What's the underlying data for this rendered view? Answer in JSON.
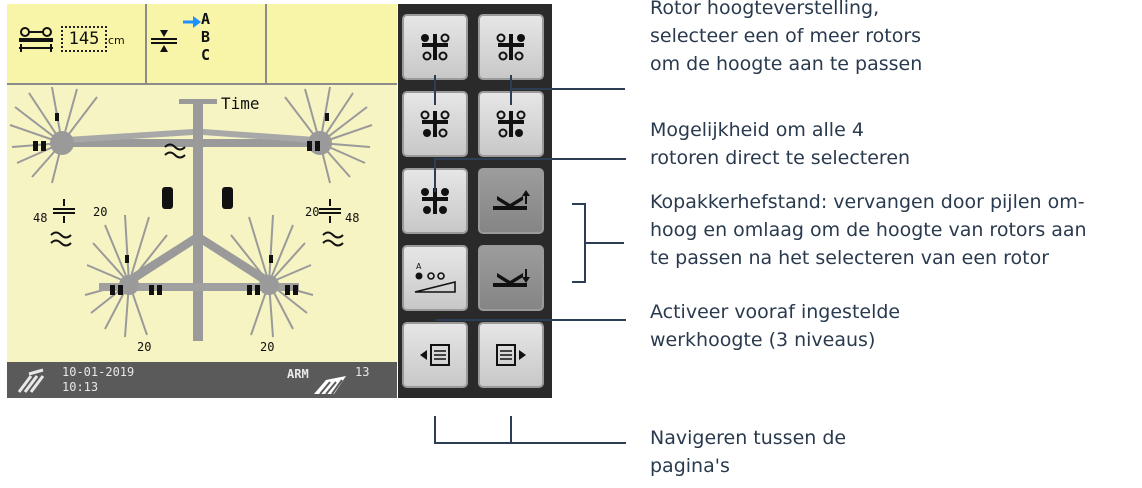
{
  "screen": {
    "topbar": {
      "height_value": "145",
      "height_unit": "cm",
      "levels": [
        "A",
        "B",
        "C"
      ]
    },
    "field": {
      "time_label": "Time",
      "width_left": "48",
      "width_right": "48",
      "distance_left": "20",
      "distance_right": "20",
      "rear_left": "20",
      "rear_right": "20"
    },
    "status": {
      "date": "10-01-2019",
      "time": "10:13",
      "mode": "ARM",
      "count": "13"
    }
  },
  "buttons": [
    {
      "name": "rotor-left-front-button",
      "icon": "rotor-select-icon"
    },
    {
      "name": "rotor-right-front-button",
      "icon": "rotor-select-icon"
    },
    {
      "name": "rotor-left-rear-button",
      "icon": "rotor-select-icon"
    },
    {
      "name": "rotor-right-rear-button",
      "icon": "rotor-select-icon"
    },
    {
      "name": "all-rotors-button",
      "icon": "all-rotors-icon"
    },
    {
      "name": "headland-raise-button",
      "icon": "headland-up-icon"
    },
    {
      "name": "preset-height-button",
      "icon": "preset-height-icon"
    },
    {
      "name": "headland-lower-button",
      "icon": "headland-down-icon"
    },
    {
      "name": "page-prev-button",
      "icon": "page-prev-icon"
    },
    {
      "name": "page-next-button",
      "icon": "page-next-icon"
    }
  ],
  "annotations": {
    "rotor_height": [
      "Rotor hoogteverstelling,",
      "selecteer een of meer rotors",
      "om de hoogte aan te passen"
    ],
    "all_rotors": [
      "Mogelijkheid om alle 4",
      "rotoren direct te selecteren"
    ],
    "headland": [
      "Kopakkerhefstand: vervangen door pijlen om-",
      "hoog en omlaag om de hoogte van rotors aan",
      "te passen na het selecteren van een rotor"
    ],
    "preset": [
      "Activeer vooraf ingestelde",
      "werkhoogte (3 niveaus)"
    ],
    "navigate": [
      "Navigeren tussen de",
      "pagina's"
    ]
  },
  "colors": {
    "screen_bg": "#f6f4c2",
    "topbar_bg": "#f8f4a8",
    "status_bg": "#5a5a5a",
    "arrow_blue": "#1e90ff",
    "line_color": "#2c3e55"
  }
}
